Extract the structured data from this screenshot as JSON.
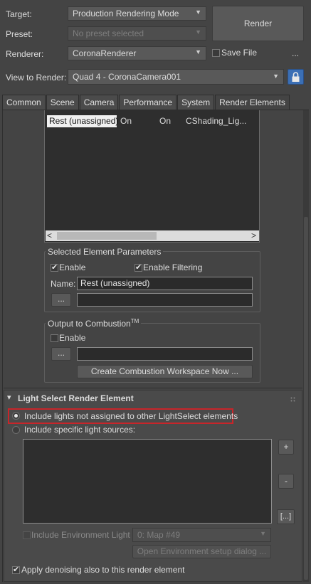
{
  "header": {
    "target_label": "Target:",
    "target_value": "Production Rendering Mode",
    "preset_label": "Preset:",
    "preset_value": "No preset selected",
    "renderer_label": "Renderer:",
    "renderer_value": "CoronaRenderer",
    "view_label": "View to Render:",
    "view_value": "Quad 4 - CoronaCamera001",
    "render_button": "Render",
    "save_file_label": "Save File",
    "save_file_checked": false,
    "ellipsis_button": "..."
  },
  "tabs": [
    {
      "label": "Common",
      "active": false
    },
    {
      "label": "Scene",
      "active": false
    },
    {
      "label": "Camera",
      "active": false
    },
    {
      "label": "Performance",
      "active": false
    },
    {
      "label": "System",
      "active": false
    },
    {
      "label": "Render Elements",
      "active": true
    }
  ],
  "elements_list": {
    "rows": [
      {
        "name": "Rest (unassigned)",
        "enabled": "On",
        "filter": "On",
        "type": "CShading_Lig..."
      }
    ],
    "scroll_left": "<",
    "scroll_right": ">"
  },
  "selected_params": {
    "title": "Selected Element Parameters",
    "enable_label": "Enable",
    "enable_checked": true,
    "filtering_label": "Enable Filtering",
    "filtering_checked": true,
    "name_label": "Name:",
    "name_value": "Rest (unassigned)",
    "browse_button": "...",
    "path_value": ""
  },
  "combustion": {
    "title": "Output to Combustion",
    "title_tm": "TM",
    "enable_label": "Enable",
    "enable_checked": false,
    "browse_button": "...",
    "path_value": "",
    "create_button": "Create Combustion Workspace Now ..."
  },
  "light_select": {
    "title": "Light Select Render Element",
    "collapse_icon": "▾",
    "option_unassigned": "Include lights not assigned to other LightSelect elements",
    "option_specific": "Include specific light sources:",
    "add_button": "+",
    "remove_button": "-",
    "list_button": "[...]",
    "env_light_label": "Include Environment Light",
    "env_map_value": "0: Map #49",
    "open_env_button": "Open Environment setup dialog ...",
    "denoise_label": "Apply denoising also to this render element",
    "denoise_checked": true,
    "highlight_color": "#c8252a"
  }
}
